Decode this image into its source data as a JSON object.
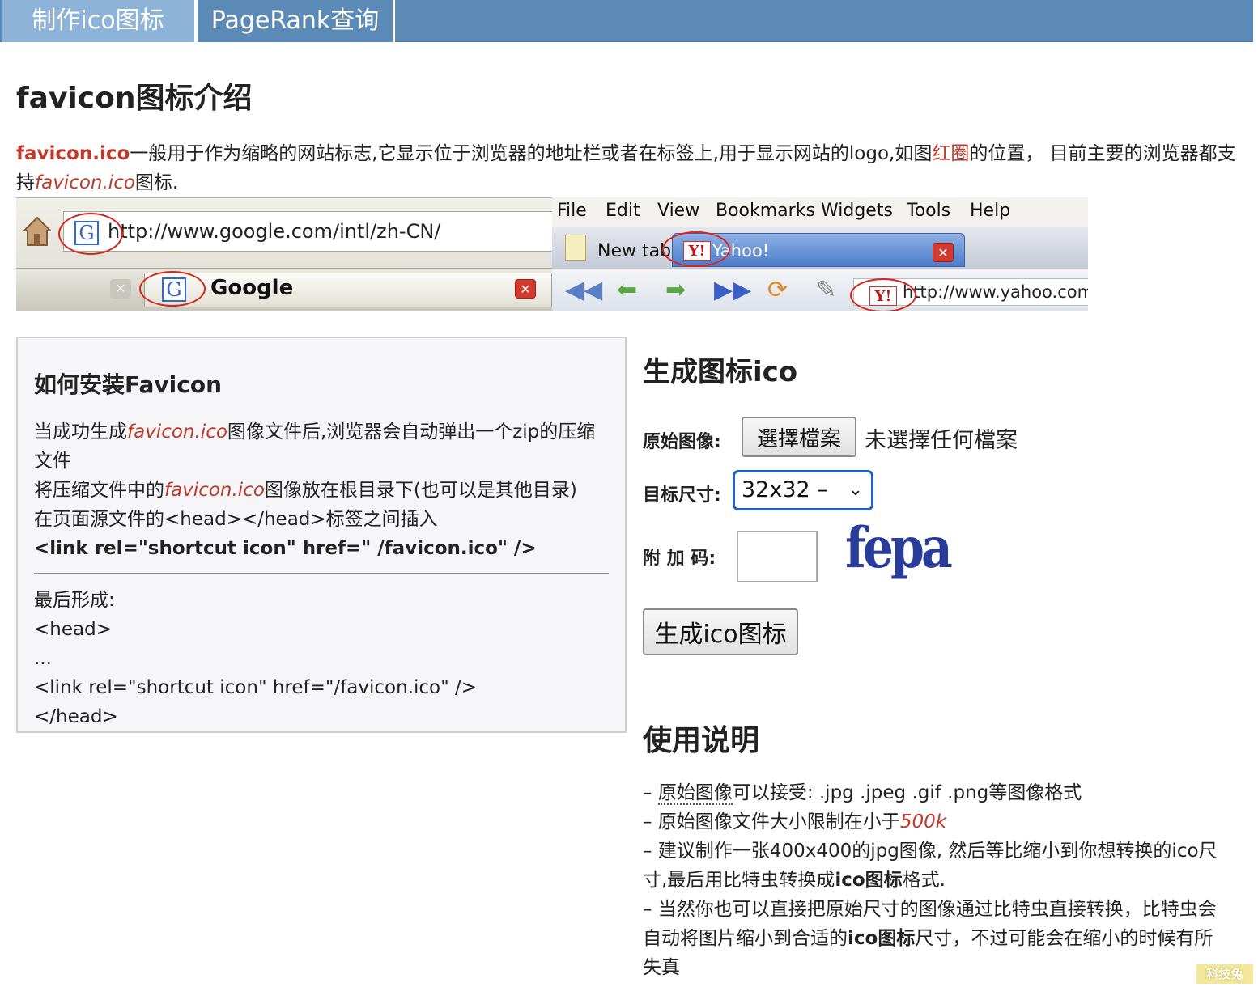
{
  "nav": {
    "tabs": [
      {
        "label": "制作ico图标"
      },
      {
        "label": "PageRank查询"
      }
    ]
  },
  "intro": {
    "heading": "favicon图标介绍",
    "lead_link": "favicon.ico",
    "text1": "一般用于作为缩略的网站标志,它显示位于浏览器的地址栏或者在标签上,用于显示网站的logo,如图",
    "red_circle": "红圈",
    "text2": "的位置， 目前主要的浏览器都支持",
    "italic_link": "favicon.ico",
    "text3": "图标."
  },
  "screenshot_left": {
    "url": "http://www.google.com/intl/zh-CN/",
    "tab_title": "Google",
    "favicon_letter": "G"
  },
  "screenshot_right": {
    "menu": [
      "File",
      "Edit",
      "View",
      "Bookmarks",
      "Widgets",
      "Tools",
      "Help"
    ],
    "newtab_label": "New tab",
    "tab_title": "Yahoo!",
    "url": "http://www.yahoo.com",
    "favicon_letters": "Y!"
  },
  "install": {
    "title": "如何安装Favicon",
    "p1_a": "当成功生成",
    "p1_link": "favicon.ico",
    "p1_b": "图像文件后,浏览器会自动弹出一个zip的压缩文件",
    "p2_a": "将压缩文件中的",
    "p2_link": "favicon.ico",
    "p2_b": "图像放在根目录下(也可以是其他目录)",
    "p3": "在页面源文件的<head></head>标签之间插入",
    "code": "<link rel=\"shortcut icon\" href=\" /favicon.ico\" />",
    "result_label": "最后形成:",
    "result_lines": [
      "<head>",
      "...",
      "<link rel=\"shortcut icon\" href=\"/favicon.ico\" />",
      "</head>"
    ]
  },
  "generator": {
    "title": "生成图标ico",
    "source_label": "原始图像:",
    "file_button": "選擇檔案",
    "file_status": "未選擇任何檔案",
    "size_label": "目标尺寸:",
    "size_value": "32x32 –",
    "captcha_label": "附 加 码:",
    "captcha_text": "fepa",
    "submit": "生成ico图标"
  },
  "usage": {
    "title": "使用说明",
    "l1_dash": "– ",
    "l1_dotted": "原始图像",
    "l1_rest": "可以接受: .jpg .jpeg .gif .png等图像格式",
    "l2_a": "– 原始图像文件大小限制在小于",
    "l2_red": "500k",
    "l3_a": "– 建议制作一张400x400的jpg图像, 然后等比缩小到你想转换的ico尺寸,最后用比特虫转换成",
    "l3_bold": "ico图标",
    "l3_b": "格式.",
    "l4_a": "– 当然你也可以直接把原始尺寸的图像通过比特虫直接转换，比特虫会自动将图片缩小到合适的",
    "l4_bold": "ico图标",
    "l4_b": "尺寸，不过可能会在缩小的时候有所失真"
  },
  "watermark": "科技兔",
  "colors": {
    "nav_bg": "#5c8ab6",
    "nav_active": "#8db3d9",
    "accent_red": "#c0392b",
    "select_focus": "#1c62c9"
  }
}
